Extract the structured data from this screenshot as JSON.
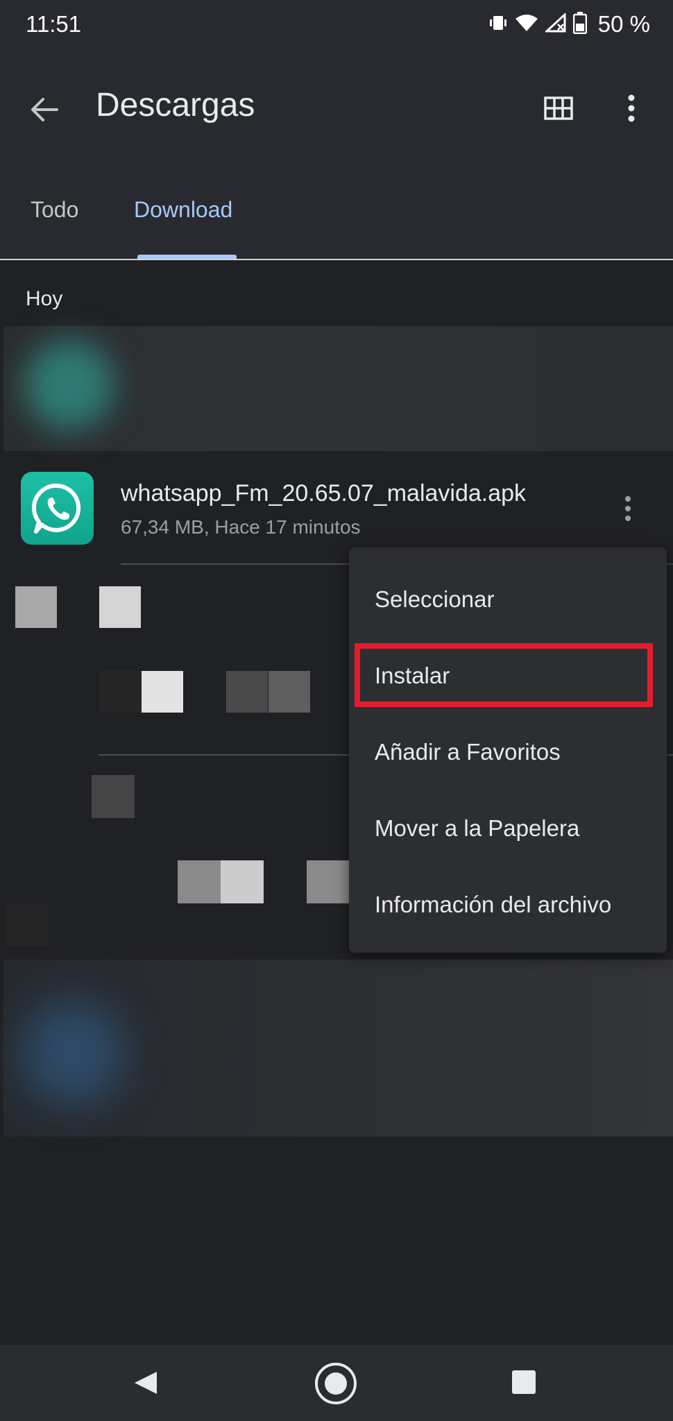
{
  "status_bar": {
    "time": "11:51",
    "battery_percent": "50 %",
    "icons": [
      "vibrate-icon",
      "wifi-icon",
      "signal-icon",
      "battery-icon"
    ]
  },
  "app_bar": {
    "title": "Descargas",
    "back_icon": "arrow-left-icon",
    "grid_icon": "grid-view-icon",
    "more_icon": "more-vert-icon"
  },
  "tabs": [
    {
      "label": "Todo",
      "selected": false
    },
    {
      "label": "Download",
      "selected": true
    }
  ],
  "section": {
    "header": "Hoy"
  },
  "file": {
    "name": "whatsapp_Fm_20.65.07_malavida.apk",
    "meta": "67,34 MB, Hace 17 minutos",
    "icon": "whatsapp-icon",
    "icon_color": "#1ebfa6"
  },
  "context_menu": {
    "items": [
      {
        "label": "Seleccionar"
      },
      {
        "label": "Instalar",
        "highlighted": true
      },
      {
        "label": "Añadir a Favoritos"
      },
      {
        "label": "Mover a la Papelera"
      },
      {
        "label": "Información del archivo"
      }
    ],
    "highlight_color": "#e21d2d"
  },
  "nav_bar": {
    "icons": [
      "nav-back-icon",
      "nav-home-icon",
      "nav-recents-icon"
    ]
  },
  "colors": {
    "background": "#202124",
    "app_bar": "#292a2f",
    "accent": "#a8c7fa",
    "menu": "#2d2e31"
  }
}
